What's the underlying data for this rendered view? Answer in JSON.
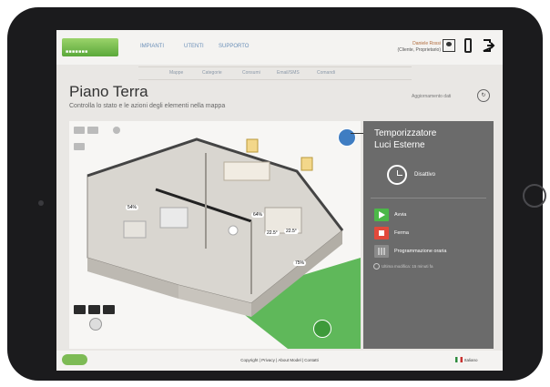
{
  "header": {
    "nav": [
      "IMPIANTI",
      "UTENTI",
      "SUPPORTO"
    ],
    "user_name": "Daniele Rossi",
    "user_role": "(Cliente, Proprietario)"
  },
  "subnav": [
    "Mappe",
    "Categorie",
    "Consumi",
    "Email/SMS",
    "Comandi"
  ],
  "page": {
    "title": "Piano Terra",
    "subtitle": "Controlla lo stato e le azioni degli elementi nella mappa",
    "refresh_label": "Aggiornamento dati"
  },
  "map": {
    "badges": [
      "54%",
      "22.5°",
      "22.5°",
      "64%",
      "75%"
    ]
  },
  "panel": {
    "title_line1": "Temporizzatore",
    "title_line2": "Luci Esterne",
    "state": "Disattivo",
    "actions": [
      {
        "label": "Avvia",
        "color": "#4cb848"
      },
      {
        "label": "Ferma",
        "color": "#e2493b"
      },
      {
        "label": "Programmazione oraria",
        "color": "#8a8a8a"
      }
    ],
    "note": "Ultima modifica: 15 minuti fa"
  },
  "footer": {
    "links": "Copyright | Privacy | About Model | Contatti",
    "language": "Italiano"
  },
  "colors": {
    "bezel": "#1b1b1d",
    "panel": "#6b6b6b",
    "grass": "#5fb85a",
    "accent_green": "#4cb848",
    "accent_red": "#e2493b"
  }
}
